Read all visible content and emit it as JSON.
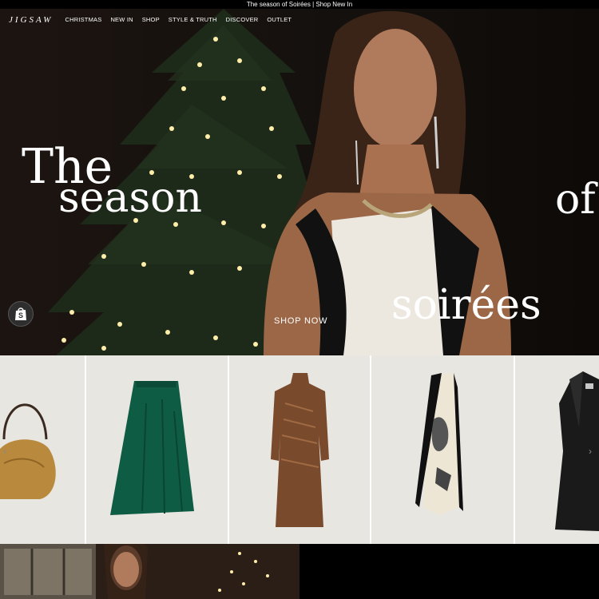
{
  "announcement": "The season of Soirées | Shop New In",
  "brand": {
    "logo_text": "JIGSAW"
  },
  "nav": {
    "items": [
      "CHRISTMAS",
      "NEW IN",
      "SHOP",
      "STYLE & TRUTH",
      "DISCOVER",
      "OUTLET"
    ]
  },
  "hero": {
    "headline_1": "The",
    "headline_2": "season",
    "headline_3": "of",
    "headline_4": "soirées",
    "cta": "SHOP NOW"
  },
  "products": {
    "items": [
      "gold-shoulder-bag",
      "green-satin-skirt",
      "bronze-print-dress",
      "printed-scarf",
      "black-wool-coat"
    ],
    "prev_icon": "chevron-left-icon",
    "next_icon": "chevron-right-icon"
  },
  "colors": {
    "announcement_bg": "#000000",
    "hero_bg": "#120d0a",
    "product_bg": "#e8e6e1",
    "text_light": "#ffffff"
  }
}
